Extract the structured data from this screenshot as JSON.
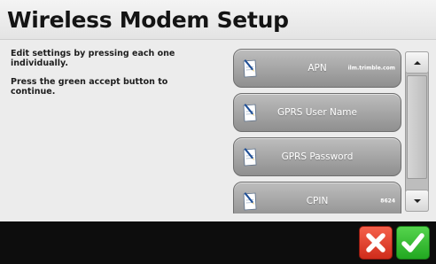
{
  "header": {
    "title": "Wireless Modem Setup"
  },
  "instructions": {
    "line1": "Edit settings by pressing each one individually.",
    "line2": "Press the green accept button to continue."
  },
  "settings": [
    {
      "label": "APN",
      "value": "ilm.trimble.com",
      "icon": "edit-note-icon"
    },
    {
      "label": "GPRS User Name",
      "value": "",
      "icon": "edit-note-icon"
    },
    {
      "label": "GPRS Password",
      "value": "",
      "icon": "edit-note-icon"
    },
    {
      "label": "CPIN",
      "value": "8624",
      "icon": "edit-note-icon"
    }
  ],
  "actions": {
    "cancel_icon": "close-icon",
    "accept_icon": "checkmark-icon",
    "cancel_color": "#e0402c",
    "accept_color": "#2fb82d"
  }
}
